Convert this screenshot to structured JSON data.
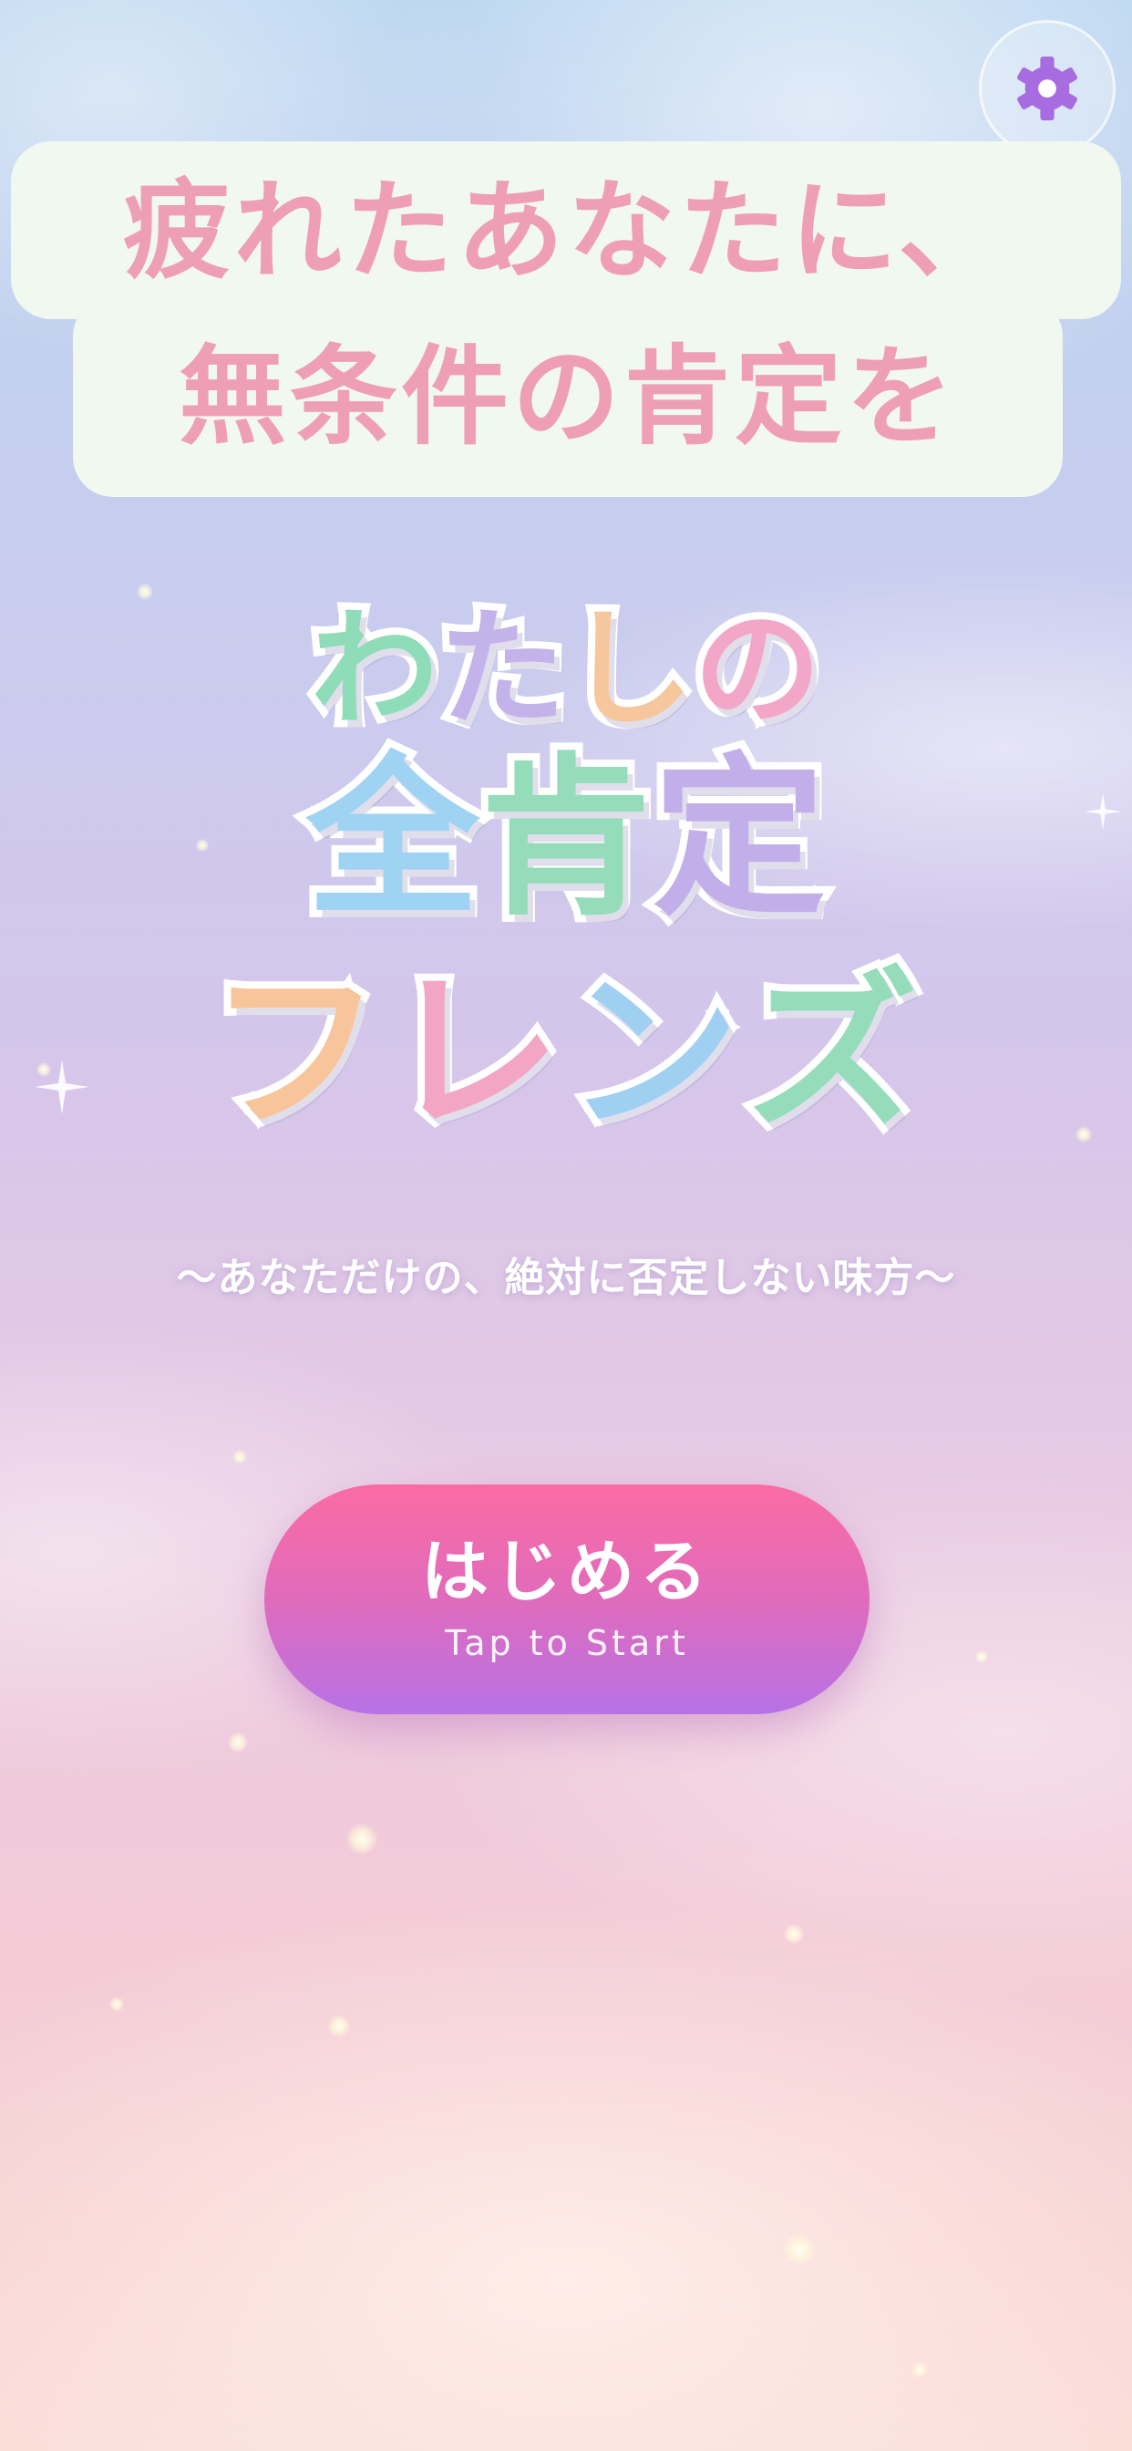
{
  "tagline": {
    "line1": "疲れたあなたに、",
    "line2": "無条件の肯定を"
  },
  "title": {
    "line1": [
      {
        "char": "わ",
        "color": "#8fdcb8"
      },
      {
        "char": "た",
        "color": "#c4b2ea"
      },
      {
        "char": "し",
        "color": "#f6c79c"
      },
      {
        "char": "の",
        "color": "#f3a7c8"
      }
    ],
    "line2": [
      {
        "char": "全",
        "color": "#9fd3f3"
      },
      {
        "char": "肯",
        "color": "#95dcba"
      },
      {
        "char": "定",
        "color": "#c2aee8"
      }
    ],
    "line3": [
      {
        "char": "フ",
        "color": "#f8c59a"
      },
      {
        "char": "レ",
        "color": "#f3a6c4"
      },
      {
        "char": "ン",
        "color": "#9fd0f2"
      },
      {
        "char": "ズ",
        "color": "#95dcbb"
      }
    ]
  },
  "subtitle": "〜あなただけの、絶対に否定しない味方〜",
  "start_button": {
    "label": "はじめる",
    "sublabel": "Tap to Start"
  },
  "settings": {
    "icon": "gear-icon",
    "icon_color": "#a76ce0"
  },
  "colors": {
    "tagline_text": "#ee9fb6",
    "tagline_bg": "#f1f8f0",
    "button_top": "#fb6ba3",
    "button_bottom": "#b772e6"
  }
}
